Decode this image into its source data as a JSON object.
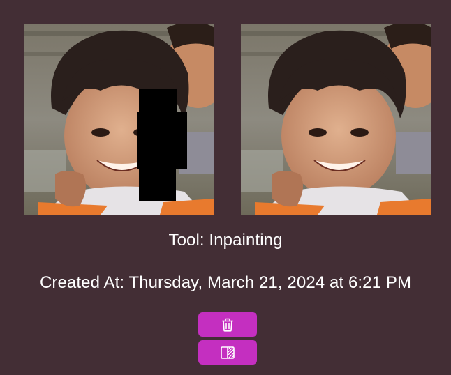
{
  "images": {
    "original_alt": "Original image with mask",
    "result_alt": "Inpainted result image"
  },
  "details": {
    "tool_text": "Tool: Inpainting",
    "created_text": "Created At: Thursday, March 21, 2024 at 6:21 PM"
  },
  "actions": {
    "delete_icon": "trash-icon",
    "compare_icon": "compare-icon"
  },
  "colors": {
    "background": "#432e35",
    "button": "#c42fc0",
    "text": "#ffffff"
  }
}
